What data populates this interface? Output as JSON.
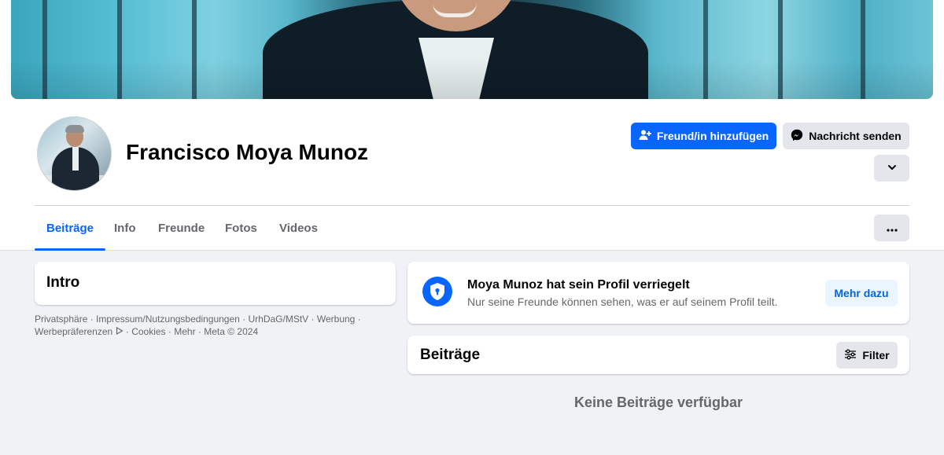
{
  "profile": {
    "name": "Francisco Moya Munoz"
  },
  "actions": {
    "add_friend_label": "Freund/in hinzufügen",
    "add_friend_icon": "person-add-icon",
    "message_label": "Nachricht senden",
    "message_icon": "messenger-icon",
    "expand_icon": "chevron-down-icon",
    "more_icon": "more-horizontal-icon"
  },
  "tabs": [
    {
      "label": "Beiträge",
      "active": true
    },
    {
      "label": "Info",
      "active": false
    },
    {
      "label": "Freunde",
      "active": false
    },
    {
      "label": "Fotos",
      "active": false
    },
    {
      "label": "Videos",
      "active": false
    }
  ],
  "intro": {
    "title": "Intro"
  },
  "footer": {
    "links": [
      "Privatsphäre",
      "Impressum/Nutzungsbedingungen",
      "UrhDaG/MStV",
      "Werbung",
      "Werbepräferenzen",
      "Cookies",
      "Mehr"
    ],
    "copyright": "Meta © 2024",
    "separator": " · ",
    "ad_choices_icon": "ad-choices-icon"
  },
  "lock_notice": {
    "icon": "shield-lock-icon",
    "title": "Moya Munoz hat sein Profil verriegelt",
    "subtitle": "Nur seine Freunde können sehen, was er auf seinem Profil teilt.",
    "button_label": "Mehr dazu"
  },
  "posts": {
    "title": "Beiträge",
    "filter_label": "Filter",
    "filter_icon": "sliders-icon",
    "empty_text": "Keine Beiträge verfügbar"
  },
  "colors": {
    "accent": "#0866ff",
    "background": "#f0f2f5",
    "secondary_text": "#65676b",
    "button_grey": "#e4e6eb"
  }
}
